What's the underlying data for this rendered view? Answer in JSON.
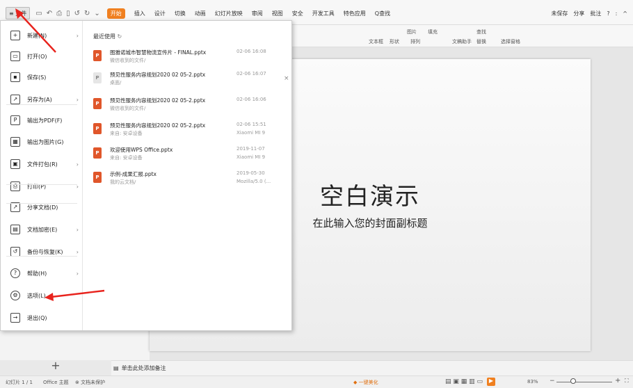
{
  "menubar": {
    "file_label": "≡ 文件",
    "quick_icons": [
      "save-icon",
      "undo-icon",
      "print-icon",
      "preview-icon"
    ],
    "tabs": [
      "开始",
      "插入",
      "设计",
      "切换",
      "动画",
      "幻灯片放映",
      "审阅",
      "视图",
      "安全",
      "开发工具",
      "特色应用",
      "Q查找"
    ],
    "right_items": [
      "未保存",
      "分享",
      "批注",
      "?",
      ":",
      "^"
    ]
  },
  "ribbon": {
    "items": [
      "文本框",
      "形状",
      "排列",
      "图片",
      "填充",
      "文稿助手",
      "查找",
      "替换",
      "选择窗格"
    ]
  },
  "file_menu": {
    "items": [
      {
        "label": "新建(N)",
        "icon": "new-doc-icon",
        "has_arrow": true
      },
      {
        "label": "打开(O)",
        "icon": "folder-icon",
        "has_arrow": false
      },
      {
        "label": "保存(S)",
        "icon": "save-icon",
        "has_arrow": false
      },
      {
        "label": "另存为(A)",
        "icon": "save-as-icon",
        "has_arrow": true
      },
      {
        "label": "输出为PDF(F)",
        "icon": "pdf-icon",
        "has_arrow": false
      },
      {
        "label": "输出为图片(G)",
        "icon": "image-export-icon",
        "has_arrow": false
      },
      {
        "label": "文件打包(R)",
        "icon": "package-icon",
        "has_arrow": true
      },
      {
        "label": "打印(P)",
        "icon": "print-icon",
        "has_arrow": true
      },
      {
        "label": "分享文档(D)",
        "icon": "share-icon",
        "has_arrow": false
      },
      {
        "label": "文档加密(E)",
        "icon": "lock-icon",
        "has_arrow": true
      },
      {
        "label": "备份与恢复(K)",
        "icon": "backup-icon",
        "has_arrow": true
      },
      {
        "label": "帮助(H)",
        "icon": "help-icon",
        "has_arrow": true
      },
      {
        "label": "选项(L)",
        "icon": "gear-icon",
        "has_arrow": false
      },
      {
        "label": "退出(Q)",
        "icon": "exit-icon",
        "has_arrow": false
      }
    ],
    "recent_title": "最近使用",
    "recent": [
      {
        "name": "图雅诺城市智慧物流宣传片 - FINAL.pptx",
        "sub": "微信收到的文件/",
        "date": "02-06 16:08",
        "device": "",
        "style": "red"
      },
      {
        "name": "预见性服务内容规划2020 02 05-2.pptx",
        "sub": "桌面/",
        "date": "02-06 16:07",
        "device": "",
        "style": "grey"
      },
      {
        "name": "预见性服务内容规划2020 02 05-2.pptx",
        "sub": "微信收到的文件/",
        "date": "02-06 16:06",
        "device": "",
        "style": "red"
      },
      {
        "name": "预见性服务内容规划2020 02 05-2.pptx",
        "sub": "来自: 安卓设备",
        "date": "02-06 15:51",
        "device": "Xiaomi MI 9",
        "style": "red"
      },
      {
        "name": "欢迎使用WPS Office.pptx",
        "sub": "来自: 安卓设备",
        "date": "2019-11-07",
        "device": "Xiaomi MI 9",
        "style": "red"
      },
      {
        "name": "示例-成果汇报.pptx",
        "sub": "我的云文档/",
        "date": "2019-05-30",
        "device": "Mozilla/5.0 (...",
        "style": "red"
      }
    ]
  },
  "slide": {
    "title": "空白演示",
    "subtitle": "在此输入您的封面副标题"
  },
  "notes": {
    "placeholder": "单击此处添加备注"
  },
  "statusbar": {
    "slide_info": "幻灯片 1 / 1",
    "theme": "Office 主题",
    "protect": "文档未保护",
    "beautify": "一键美化",
    "zoom": "83%"
  },
  "colors": {
    "accent": "#f08020",
    "annotation": "#e8231d",
    "file_icon": "#e0562a"
  }
}
